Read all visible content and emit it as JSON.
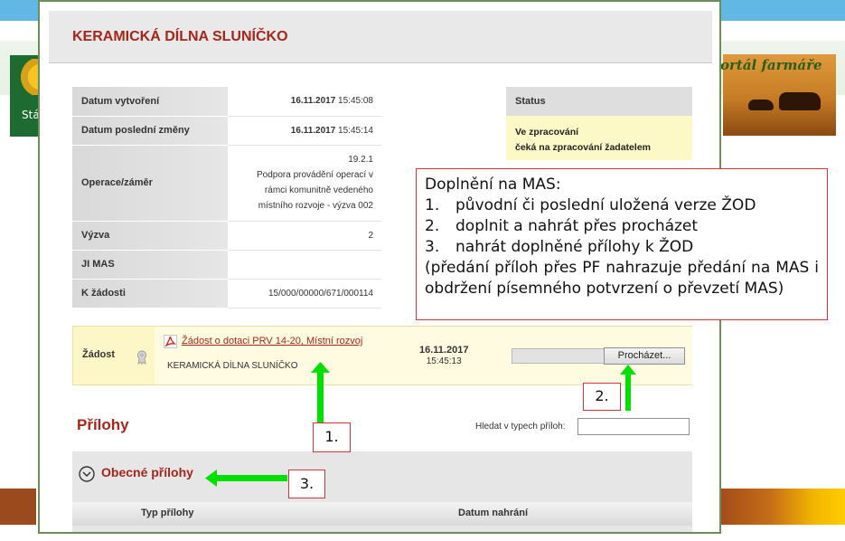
{
  "background": {
    "logo_text": "Stá",
    "banner_text": "ortál farmáře"
  },
  "dialog": {
    "title": "KERAMICKÁ DÍLNA SLUNÍČKO",
    "info_rows": [
      {
        "label": "Datum vytvoření",
        "value_bold": "16.11.2017",
        "value": " 15:45:08"
      },
      {
        "label": "Datum poslední změny",
        "value_bold": "16.11.2017",
        "value": " 15:45:14"
      },
      {
        "label": "Operace/záměr",
        "value_lines": [
          "19.2.1",
          "Podpora provádění operací v",
          "rámci komunitně vedeného",
          "místního rozvoje - výzva 002"
        ]
      },
      {
        "label": "Výzva",
        "value": "2"
      },
      {
        "label": "JI MAS",
        "value": ""
      },
      {
        "label": "K žádosti",
        "value": "15/000/00000/671/000114"
      }
    ],
    "status": {
      "header": "Status",
      "line1": "Ve zpracování",
      "line2": "čeká na zpracování žadatelem"
    },
    "zadost": {
      "label": "Žádost",
      "link": "Žádost o dotaci PRV 14-20, Místní rozvoj",
      "name": "KERAMICKÁ DÍLNA SLUNÍČKO",
      "date": "16.11.2017",
      "time": "15:45:13",
      "browse_button": "Procházet..."
    },
    "prilohy": {
      "title": "Přílohy",
      "search_label": "Hledat v typech příloh:",
      "search_value": "",
      "section_title": "Obecné přílohy",
      "columns": [
        "Typ přílohy",
        "Datum nahrání"
      ]
    }
  },
  "annotation": {
    "heading": "Doplnění na MAS:",
    "items": [
      {
        "num": "1.",
        "text": "původní či poslední uložená verze ŽOD"
      },
      {
        "num": "2.",
        "text": "doplnit a nahrát přes procházet"
      },
      {
        "num": "3.",
        "text": "nahrát doplněné přílohy k ŽOD"
      }
    ],
    "note": "(předání příloh přes PF nahrazuje předání na MAS i obdržení písemného potvrzení o převzetí MAS)",
    "tags": [
      "1.",
      "2.",
      "3."
    ],
    "arrow_color": "#00e000",
    "border_color": "#d8313a"
  }
}
